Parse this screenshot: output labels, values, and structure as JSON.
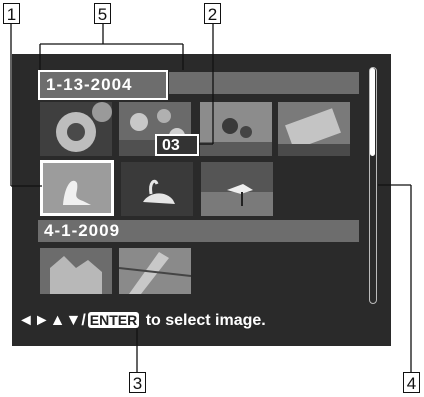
{
  "callouts": {
    "c1": "1",
    "c2": "2",
    "c3": "3",
    "c4": "4",
    "c5": "5"
  },
  "groups": [
    {
      "date": "1-13-2004"
    },
    {
      "date": "4-1-2009"
    }
  ],
  "counter": "03",
  "status": {
    "arrows": "◄►▲▼/",
    "enter": "ENTER",
    "text": " to select image."
  },
  "icons": {
    "nav": "direction-arrows-icon",
    "enter": "enter-key-icon"
  },
  "colors": {
    "screen": "#2a2a2a",
    "date_bar": "#6d6d6d",
    "highlight": "#ffffff"
  }
}
